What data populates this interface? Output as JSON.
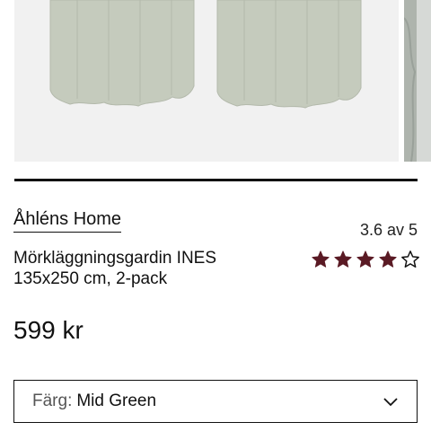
{
  "product": {
    "brand": "Åhléns Home",
    "name_line1": "Mörkläggningsgardin INES",
    "name_line2": "135x250 cm, 2-pack",
    "rating_text": "3.6 av 5",
    "rating_stars": 4,
    "rating_max": 5,
    "price": "599 kr"
  },
  "color_select": {
    "label": "Färg:",
    "value": "Mid Green"
  },
  "colors": {
    "star_filled": "#5a1a24",
    "text": "#111111",
    "curtain": "#c5cbbd"
  }
}
